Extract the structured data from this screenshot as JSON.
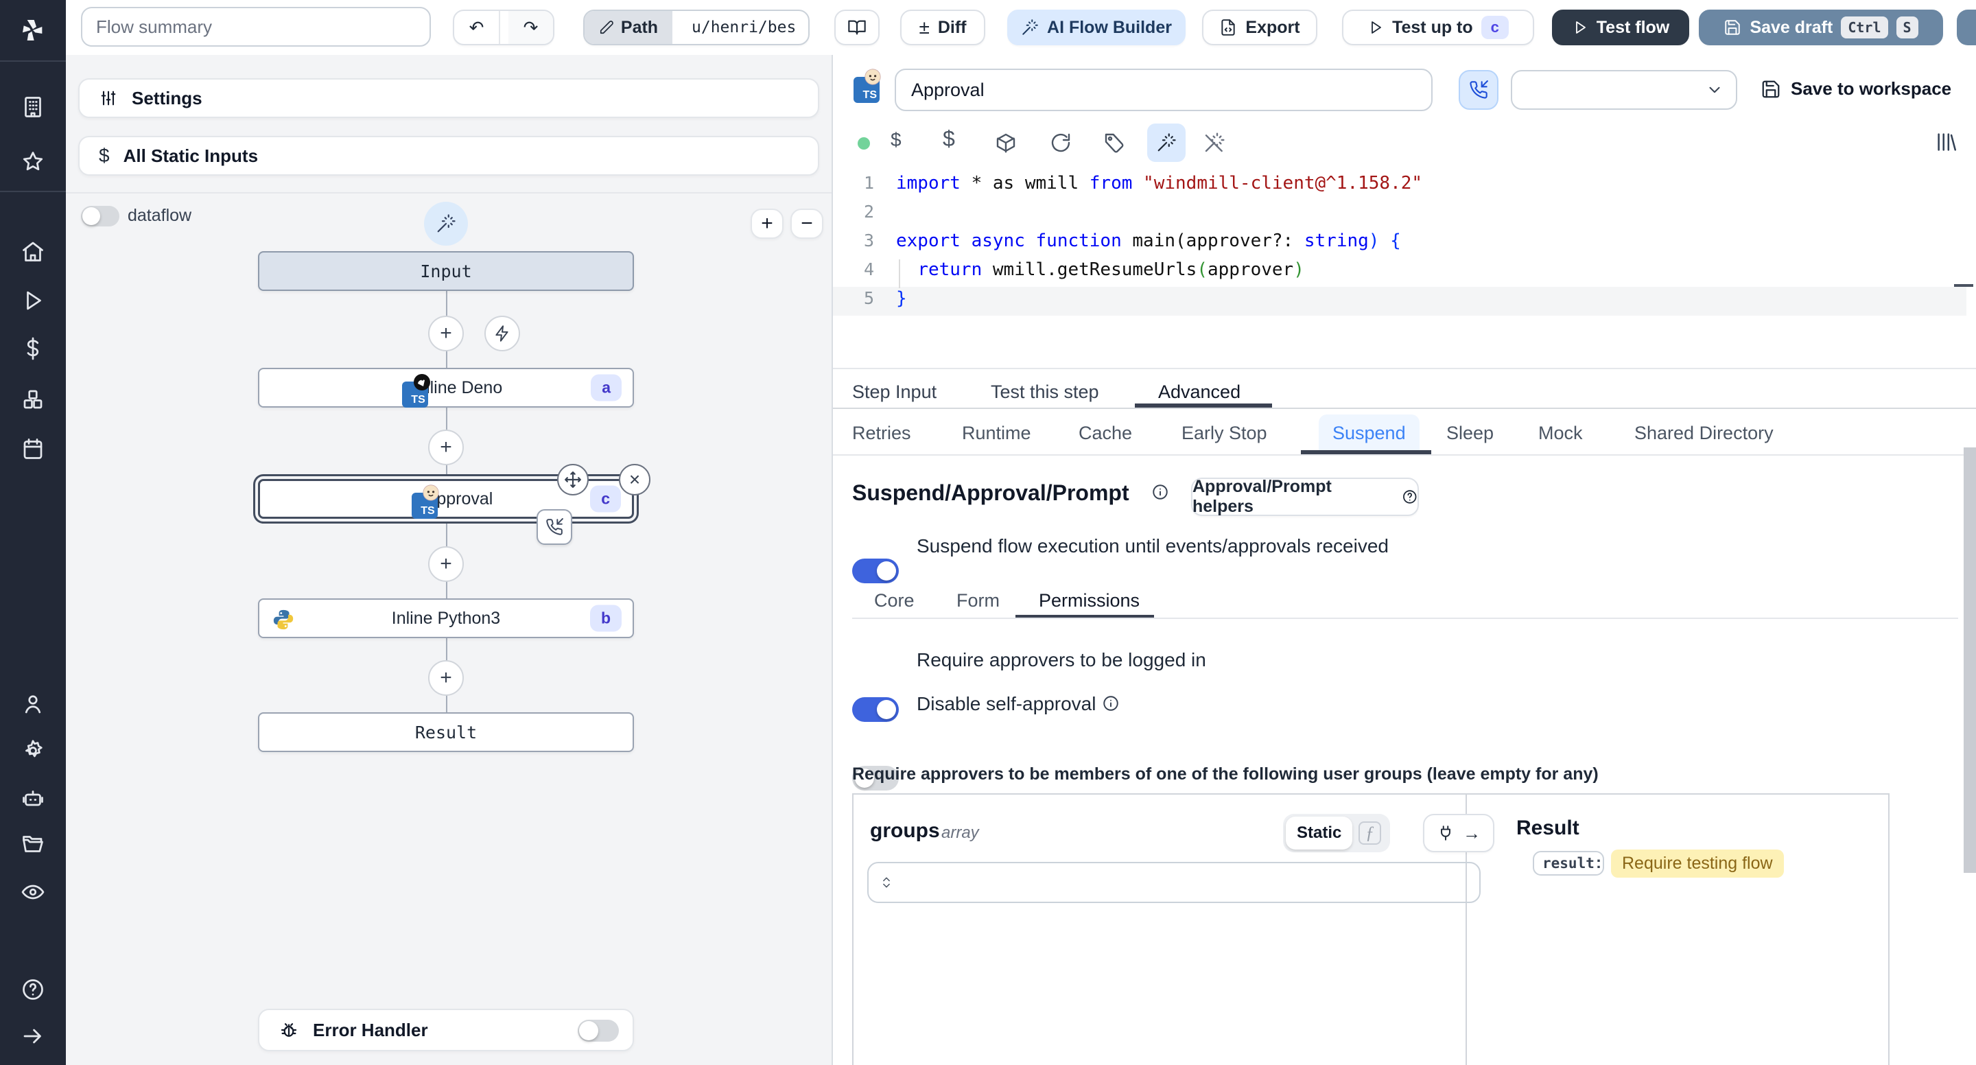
{
  "colors": {
    "accent_blue": "#3e63dd",
    "badge_bg": "#e0e7ff",
    "badge_text": "#4338ca",
    "ai_btn_bg": "#dbeafe",
    "save_draft_bg": "#6b87a3",
    "test_flow_bg": "#2e3947",
    "highlight_bg": "#fdf1b6",
    "highlight_text": "#8a6616"
  },
  "topbar": {
    "flow_summary": "Flow summary",
    "path_label": "Path",
    "path_value": "u/henri/bes",
    "diff_label": "Diff",
    "plusminus": "±",
    "ai_label": "AI Flow Builder",
    "export_label": "Export",
    "test_up_to_label": "Test up to",
    "test_up_to_badge": "c",
    "test_flow_label": "Test flow",
    "save_draft_label": "Save draft",
    "kbd_ctrl": "Ctrl",
    "kbd_s": "S"
  },
  "flow": {
    "settings_label": "Settings",
    "static_inputs_label": "All Static Inputs",
    "dataflow_label": "dataflow",
    "zoom_in": "+",
    "zoom_out": "−",
    "nodes": {
      "input": "Input",
      "deno_label": "Inline Deno",
      "deno_badge": "a",
      "approval_label": "Approval",
      "approval_badge": "c",
      "python_label": "Inline Python3",
      "python_badge": "b",
      "result": "Result"
    },
    "error_handler_label": "Error Handler"
  },
  "editor": {
    "title": "Approval",
    "save_to_workspace": "Save to workspace",
    "line_numbers": [
      "1",
      "2",
      "3",
      "4",
      "5"
    ],
    "code": {
      "l1": [
        {
          "t": "import"
        },
        {
          "t": " * as wmill "
        },
        {
          "t": "from"
        },
        {
          "t": " "
        },
        {
          "t": "\"windmill-client@^1.158.2\""
        }
      ],
      "l3": [
        {
          "t": "export"
        },
        {
          "t": " "
        },
        {
          "t": "async"
        },
        {
          "t": " "
        },
        {
          "t": "function"
        },
        {
          "t": " main("
        },
        {
          "t": "approver?: "
        },
        {
          "t": "string"
        },
        {
          "t": ") {"
        }
      ],
      "l4": [
        {
          "t": "  "
        },
        {
          "t": "return"
        },
        {
          "t": " wmill.getResumeUrls"
        },
        {
          "t": "("
        },
        {
          "t": "approver"
        },
        {
          "t": ")"
        }
      ],
      "l5": [
        {
          "t": "}"
        }
      ]
    }
  },
  "tabs": {
    "step_input": "Step Input",
    "test_step": "Test this step",
    "advanced": "Advanced"
  },
  "subtabs": [
    {
      "label": "Retries"
    },
    {
      "label": "Runtime"
    },
    {
      "label": "Cache"
    },
    {
      "label": "Early Stop"
    },
    {
      "label": "Suspend"
    },
    {
      "label": "Sleep"
    },
    {
      "label": "Mock"
    },
    {
      "label": "Shared Directory"
    }
  ],
  "suspend": {
    "heading": "Suspend/Approval/Prompt",
    "helpers_label": "Approval/Prompt helpers",
    "suspend_toggle_label": "Suspend flow execution until events/approvals received",
    "core_tab": "Core",
    "form_tab": "Form",
    "permissions_tab": "Permissions",
    "logged_in_label": "Require approvers to be logged in",
    "self_approval_label": "Disable self-approval",
    "groups_requirement": "Require approvers to be members of one of the following user groups (leave empty for any)"
  },
  "groups": {
    "name": "groups",
    "type": "array",
    "static_label": "Static"
  },
  "result_panel": {
    "title": "Result",
    "key": "result",
    "colon": ":",
    "value": "Require testing flow"
  }
}
